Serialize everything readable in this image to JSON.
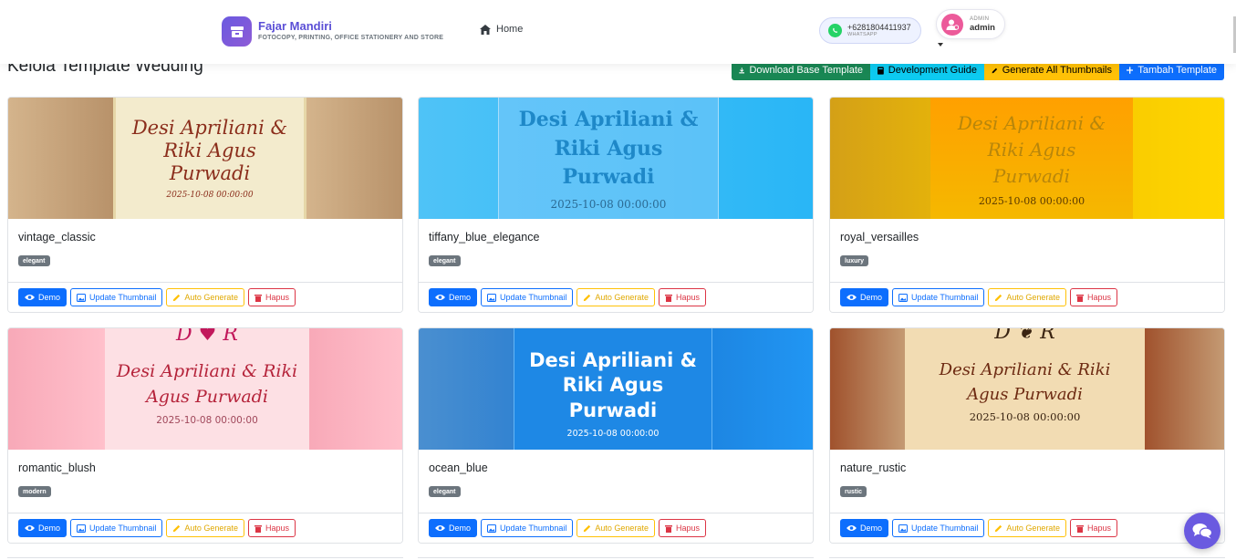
{
  "navbar": {
    "brand_name": "Fajar Mandiri",
    "brand_subtitle": "FOTOCOPY, PRINTING, OFFICE STATIONERY AND STORE",
    "home_label": "Home",
    "whatsapp_number": "+6281804411937",
    "whatsapp_label": "WHATSAPP",
    "user_role": "ADMIN",
    "user_name": "admin"
  },
  "page": {
    "title": "Kelola Template Wedding"
  },
  "toolbar": {
    "download_label": "Download Base Template",
    "guide_label": "Development Guide",
    "generate_label": "Generate All Thumbnails",
    "add_label": "Tambah Template"
  },
  "card_actions": {
    "demo": "Demo",
    "update_thumbnail": "Update Thumbnail",
    "auto_generate": "Auto Generate",
    "delete": "Hapus"
  },
  "templates": [
    {
      "name": "vintage_classic",
      "category": "elegant",
      "preview_names": "Desi Apriliani &\nRiki Agus\nPurwadi",
      "preview_date": "2025-10-08 00:00:00"
    },
    {
      "name": "tiffany_blue_elegance",
      "category": "elegant",
      "preview_names": "Desi Apriliani &\nRiki Agus\nPurwadi",
      "preview_date": "2025-10-08 00:00:00"
    },
    {
      "name": "royal_versailles",
      "category": "luxury",
      "preview_names": "Desi Apriliani &\nRiki Agus\nPurwadi",
      "preview_date": "2025-10-08 00:00:00"
    },
    {
      "name": "romantic_blush",
      "category": "modern",
      "preview_monogram": "D ♥ R",
      "preview_names": "Desi Apriliani & Riki\nAgus Purwadi",
      "preview_date": "2025-10-08 00:00:00"
    },
    {
      "name": "ocean_blue",
      "category": "elegant",
      "preview_names": "Desi Apriliani &\nRiki Agus\nPurwadi",
      "preview_date": "2025-10-08 00:00:00"
    },
    {
      "name": "nature_rustic",
      "category": "rustic",
      "preview_monogram": "D ❦ R",
      "preview_names": "Desi Apriliani & Riki\nAgus Purwadi",
      "preview_date": "2025-10-08 00:00:00"
    }
  ]
}
